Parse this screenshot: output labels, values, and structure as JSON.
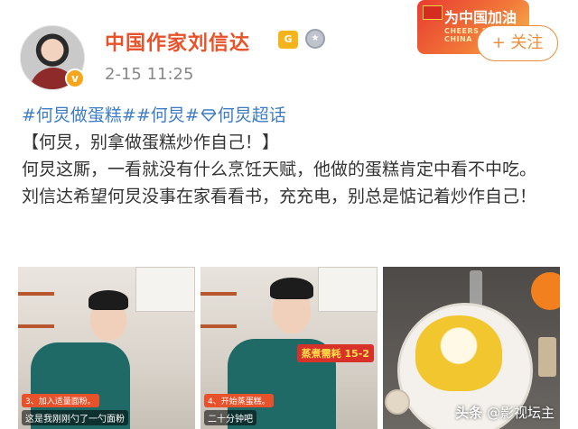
{
  "header": {
    "author_name": "中国作家刘信达",
    "post_time": "2-15 11:25",
    "follow_label": "+ 关注",
    "crown_badge_text": "G",
    "banner_text": "为中国加油",
    "banner_subtext": "CHEERS FOR CHINA",
    "verify_mark": "v"
  },
  "post": {
    "tags": [
      "#何炅做蛋糕#",
      "#何炅#",
      "何炅超话"
    ],
    "headline": "【何炅，别拿做蛋糕炒作自己！】",
    "paragraph1": "何炅这厮，一看就没有什么烹饪天赋，他做的蛋糕肯定中看不中吃。",
    "paragraph2": "刘信达希望何炅没事在家看看书，充充电，别总是惦记着炒作自己！"
  },
  "photos": [
    {
      "sub_tag": "3、加入适量面粉。",
      "caption": "这是我刚刚勺了一勺面粉"
    },
    {
      "sub_tag": "4、开始蒸蛋糕。",
      "caption": "二十分钟吧",
      "overlay_label": "蒸煮需耗 15-2"
    },
    {
      "watermark_brand": "头条",
      "watermark_text": "@影视坛主"
    }
  ],
  "colors": {
    "author_name": "#e8522a",
    "tag_link": "#3e7cc4",
    "follow_accent": "#f08c3a"
  },
  "icons": [
    "crown-badge-icon",
    "medal-badge-icon",
    "verified-icon",
    "super-topic-diamond-icon"
  ]
}
